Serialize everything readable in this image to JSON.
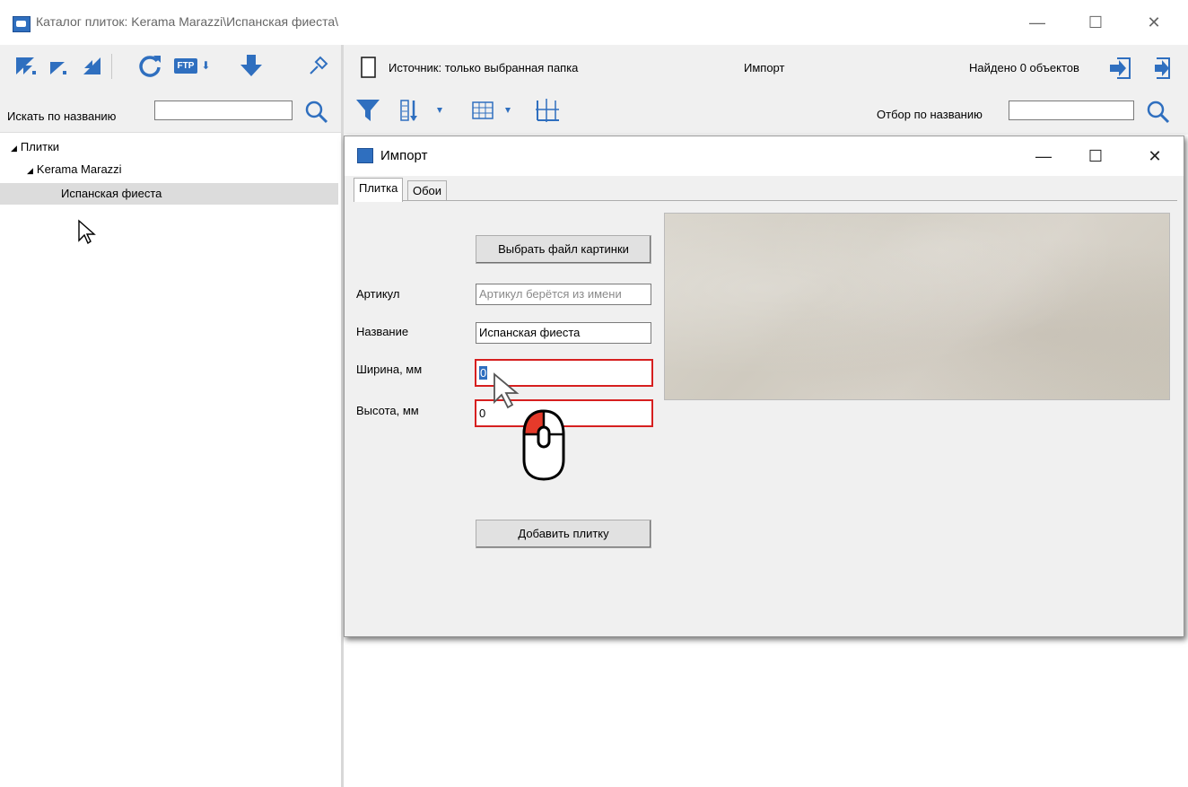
{
  "window": {
    "title": "Каталог плиток: Kerama Marazzi\\Испанская фиеста\\",
    "minimize": "—",
    "maximize": "☐",
    "close": "✕"
  },
  "left_panel": {
    "toolbar_icons": [
      "collapse-tree-icon",
      "filter-tree-icon",
      "expand-tree-icon",
      "refresh-icon",
      "ftp-icon",
      "download-icon",
      "pin-icon"
    ],
    "ftp_label": "FTP",
    "search_label": "Искать по названию",
    "search_value": "",
    "tree": [
      {
        "label": "Плитки",
        "level": 0,
        "expanded": true
      },
      {
        "label": "Kerama Marazzi",
        "level": 1,
        "expanded": true
      },
      {
        "label": "Испанская фиеста",
        "level": 2,
        "selected": true
      }
    ]
  },
  "right_panel": {
    "source_label": "Источник: только выбранная папка",
    "import_label": "Импорт",
    "found_label": "Найдено 0 объектов",
    "filter_label": "Отбор по названию",
    "filter_value": ""
  },
  "dialog": {
    "title": "Импорт",
    "minimize": "—",
    "maximize": "☐",
    "close": "✕",
    "tabs": [
      "Плитка",
      "Обои"
    ],
    "active_tab": "Плитка",
    "choose_file_button": "Выбрать файл картинки",
    "article_label": "Артикул",
    "article_placeholder": "Артикул берётся из имени",
    "name_label": "Название",
    "name_value": "Испанская фиеста",
    "width_label": "Ширина, мм",
    "width_value": "0",
    "height_label": "Высота, мм",
    "height_value": "0",
    "add_button": "Добавить плитку"
  },
  "colors": {
    "accent_blue": "#2f6fbf",
    "error_red": "#d61f1f",
    "toolbar_bg": "#f0f0f0",
    "selection_bg": "#dcdcdc"
  }
}
